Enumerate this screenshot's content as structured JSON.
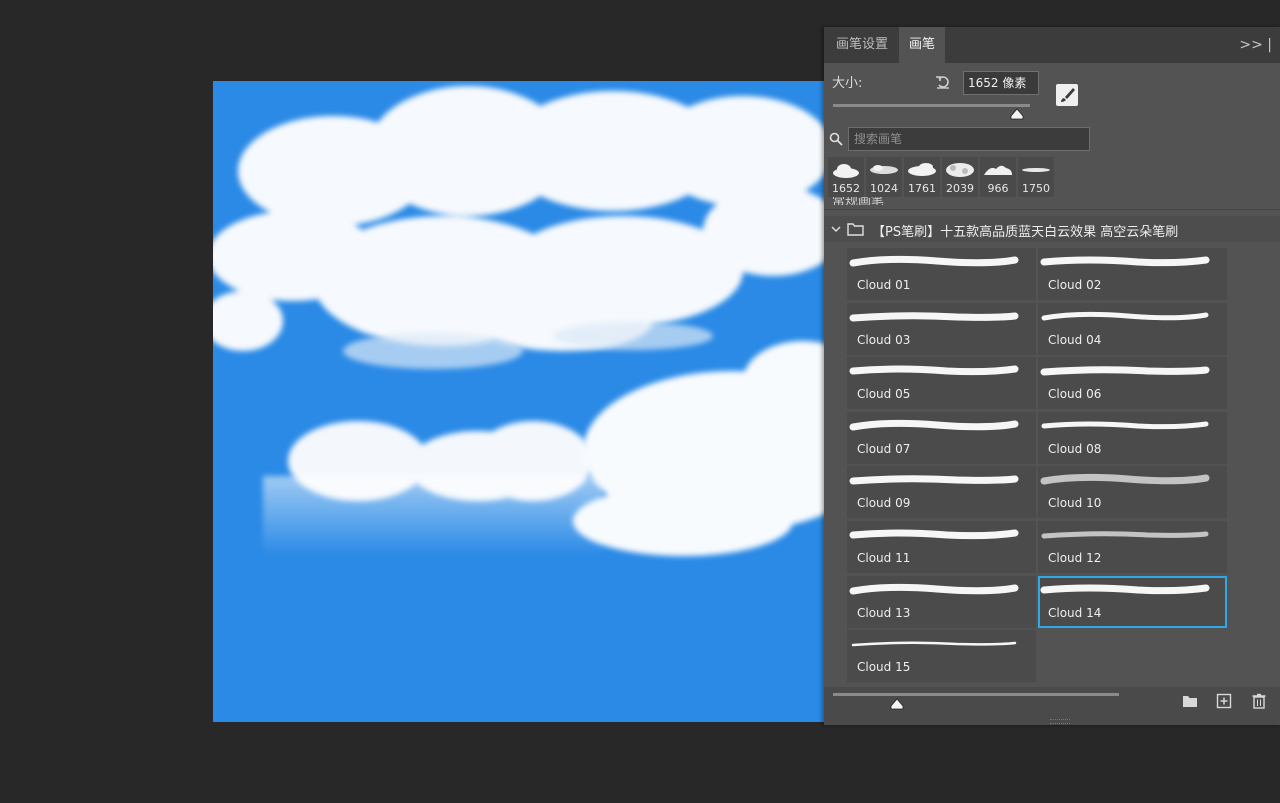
{
  "panel": {
    "tabs": [
      "画笔设置",
      "画笔"
    ],
    "active_tab": "画笔",
    "menu_label": ">> |",
    "size_label": "大小:",
    "size_value": "1652 像素",
    "search_placeholder": "搜索画笔",
    "recent_brushes": [
      "1652",
      "1024",
      "1761",
      "2039",
      "966",
      "1750"
    ],
    "hidden_group_text": "常规画笔",
    "group_name": "【PS笔刷】十五款高品质蓝天白云效果 高空云朵笔刷",
    "brushes": [
      "Cloud 01",
      "Cloud 02",
      "Cloud 03",
      "Cloud 04",
      "Cloud 05",
      "Cloud 06",
      "Cloud 07",
      "Cloud 08",
      "Cloud 09",
      "Cloud 10",
      "Cloud 11",
      "Cloud 12",
      "Cloud 13",
      "Cloud 14",
      "Cloud 15"
    ],
    "selected_brush": "Cloud 14",
    "size_slider_fraction": 0.9,
    "preview_slider_fraction": 0.23
  },
  "colors": {
    "canvas_sky": "#2a8ae6",
    "workspace": "#282828",
    "panel_bg": "#535353",
    "selection": "#2fa8e6"
  },
  "icons": {
    "reset": "reset-icon",
    "brush_edit": "brush-edit-icon",
    "search": "search-icon",
    "folder": "folder-icon",
    "new_group": "new-folder-icon",
    "new_brush": "new-brush-icon",
    "delete": "trash-icon"
  }
}
